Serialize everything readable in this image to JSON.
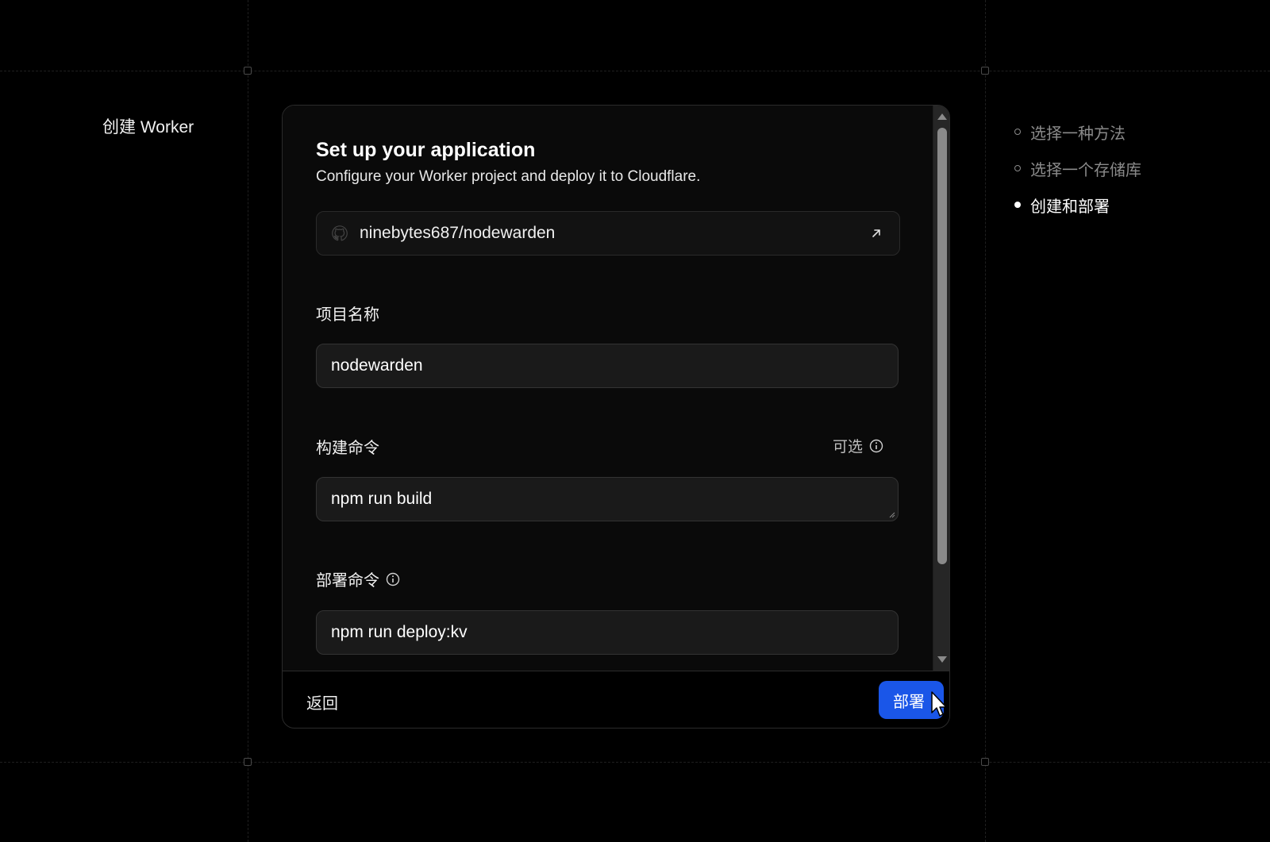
{
  "page": {
    "heading": "创建 Worker"
  },
  "card": {
    "title": "Set up your application",
    "subtitle": "Configure your Worker project and deploy it to Cloudflare.",
    "repo": {
      "icon": "github-icon",
      "name": "ninebytes687/nodewarden",
      "link_icon": "external-link-icon"
    },
    "project_name": {
      "label": "项目名称",
      "value": "nodewarden"
    },
    "build_command": {
      "label": "构建命令",
      "optional_label": "可选",
      "value": "npm run build"
    },
    "deploy_command": {
      "label": "部署命令",
      "value": "npm run deploy:kv"
    },
    "footer": {
      "back_label": "返回",
      "deploy_label": "部署"
    }
  },
  "steps": [
    {
      "label": "选择一种方法",
      "state": "done"
    },
    {
      "label": "选择一个存储库",
      "state": "done"
    },
    {
      "label": "创建和部署",
      "state": "active"
    }
  ],
  "colors": {
    "background": "#000000",
    "card_body": "#0a0a0a",
    "input_bg": "#1a1a1a",
    "accent": "#1a56e8",
    "muted_text": "#8a8a8a"
  }
}
